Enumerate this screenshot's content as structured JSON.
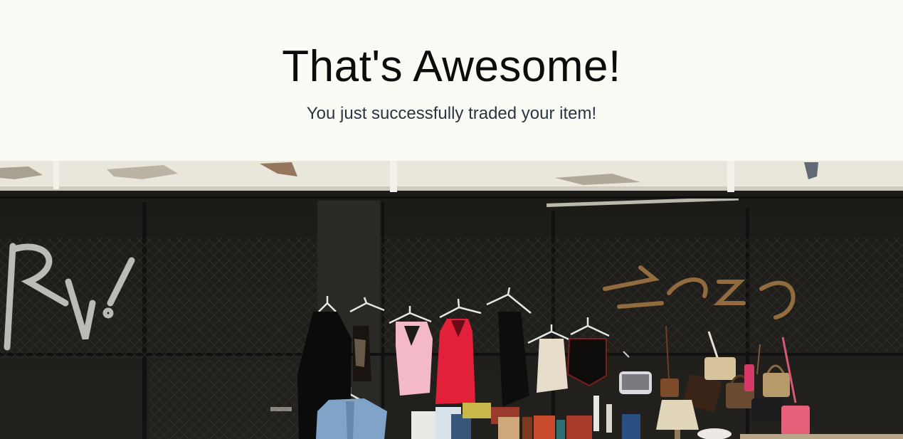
{
  "hero": {
    "title": "That's Awesome!",
    "subtitle": "You just successfully traded your item!"
  },
  "colors": {
    "page_background": "#fbfbf6",
    "title_color": "#0c0c0c",
    "subtitle_color": "#2b3442"
  }
}
